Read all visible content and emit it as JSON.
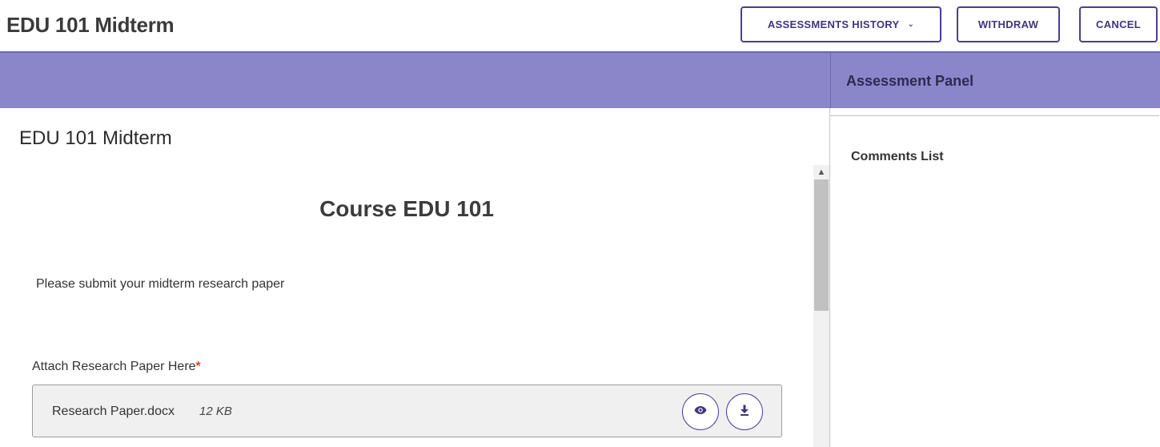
{
  "header": {
    "title": "EDU 101 Midterm",
    "history_label": "ASSESSMENTS HISTORY",
    "withdraw_label": "WITHDRAW",
    "cancel_label": "CANCEL"
  },
  "panel": {
    "title": "Assessment Panel",
    "comments_label": "Comments List"
  },
  "form": {
    "title": "EDU 101 Midterm",
    "course_heading": "Course EDU 101",
    "instructions": "Please submit your midterm research paper",
    "attach_label": "Attach Research Paper Here",
    "required_mark": "*",
    "file": {
      "name": "Research Paper.docx",
      "size": "12 KB"
    }
  },
  "colors": {
    "accent": "#4a3f8f",
    "banner": "#8b86c9",
    "required": "#d9481c"
  },
  "icons": {
    "view": "eye-icon",
    "download": "download-icon",
    "chevron": "chevron-down-icon",
    "scroll_up": "chevron-up-icon"
  }
}
